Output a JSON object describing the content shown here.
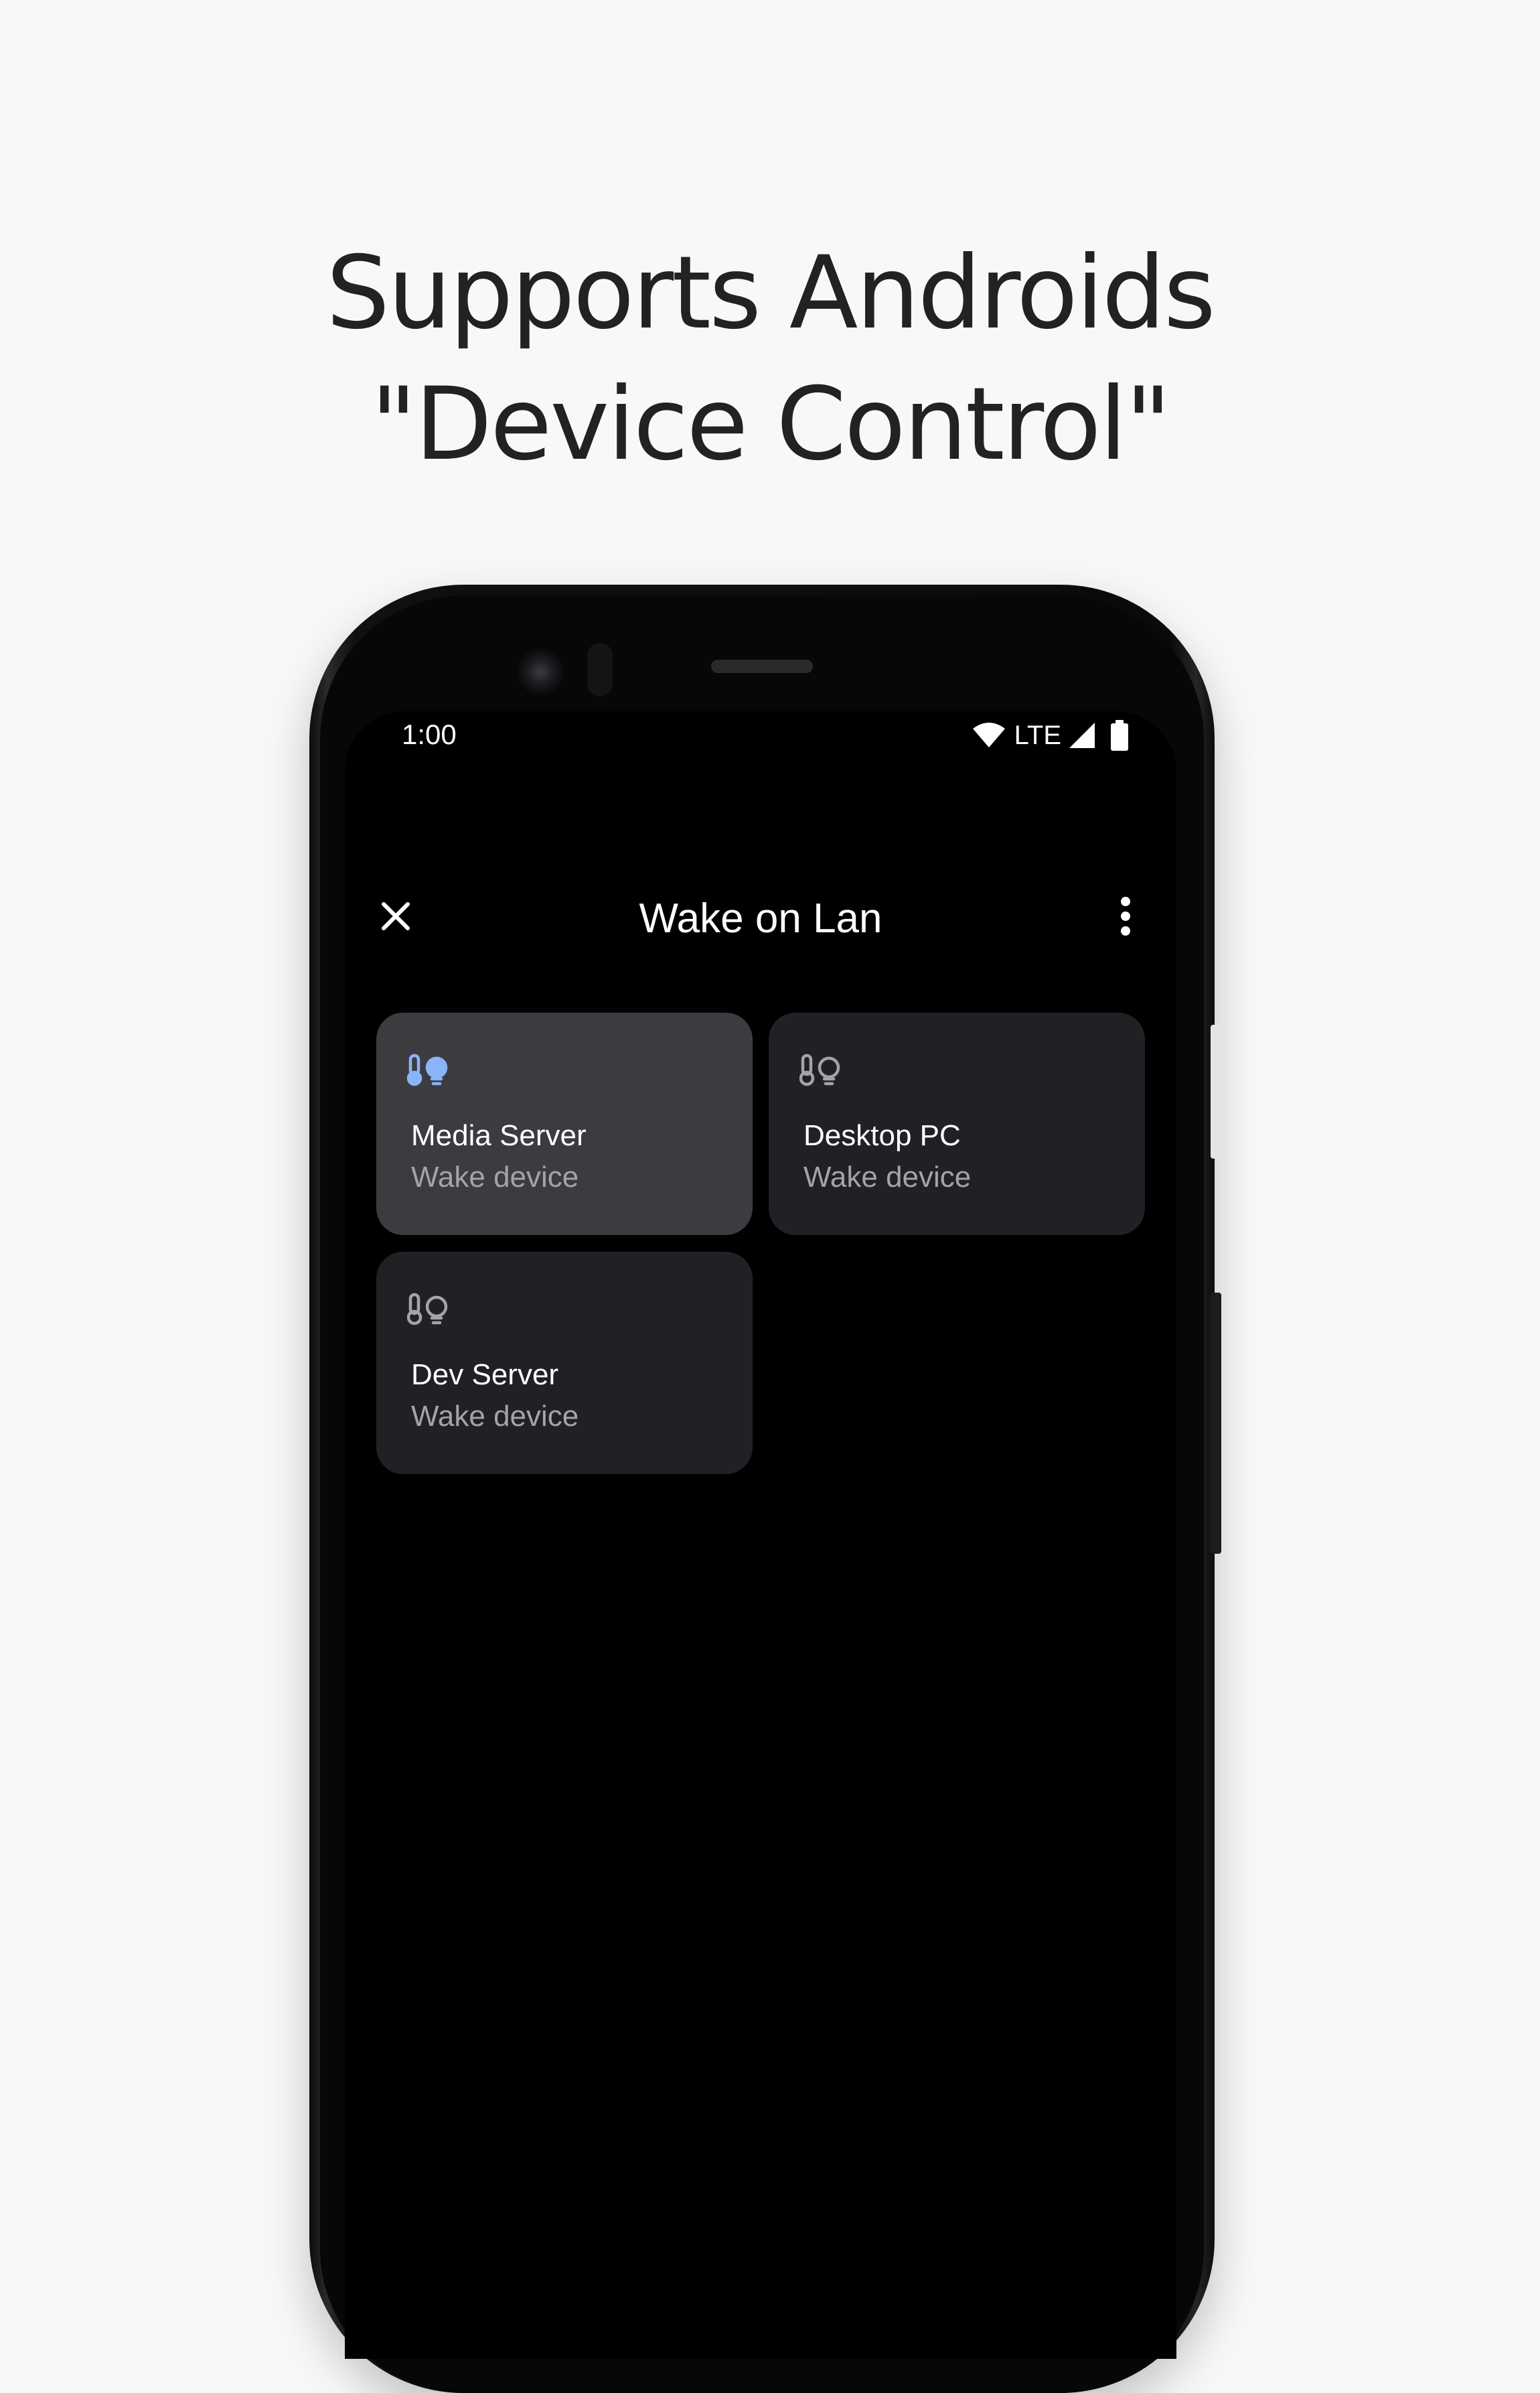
{
  "headline": {
    "line1": "Supports Androids",
    "line2": "\"Device Control\""
  },
  "status_bar": {
    "time": "1:00",
    "network_label": "LTE",
    "icons": [
      "wifi-icon",
      "cell-signal-icon",
      "battery-icon"
    ]
  },
  "app_bar": {
    "title": "Wake on Lan",
    "close_icon": "close-icon",
    "menu_icon": "more-vert-icon"
  },
  "devices": [
    {
      "name": "Media Server",
      "status": "Wake device",
      "active": true,
      "icon": "thermometer-bulb-icon"
    },
    {
      "name": "Desktop PC",
      "status": "Wake device",
      "active": false,
      "icon": "thermometer-bulb-icon"
    },
    {
      "name": "Dev Server",
      "status": "Wake device",
      "active": false,
      "icon": "thermometer-bulb-icon"
    }
  ],
  "colors": {
    "page_background": "#f8f8f8",
    "headline_text": "#222222",
    "screen_background": "#000000",
    "tile_background": "#202124",
    "tile_active_background": "#3c3c40",
    "icon_active": "#8ab4f8",
    "icon_inactive": "#a4a4a8",
    "secondary_text": "#a4a4a8"
  }
}
